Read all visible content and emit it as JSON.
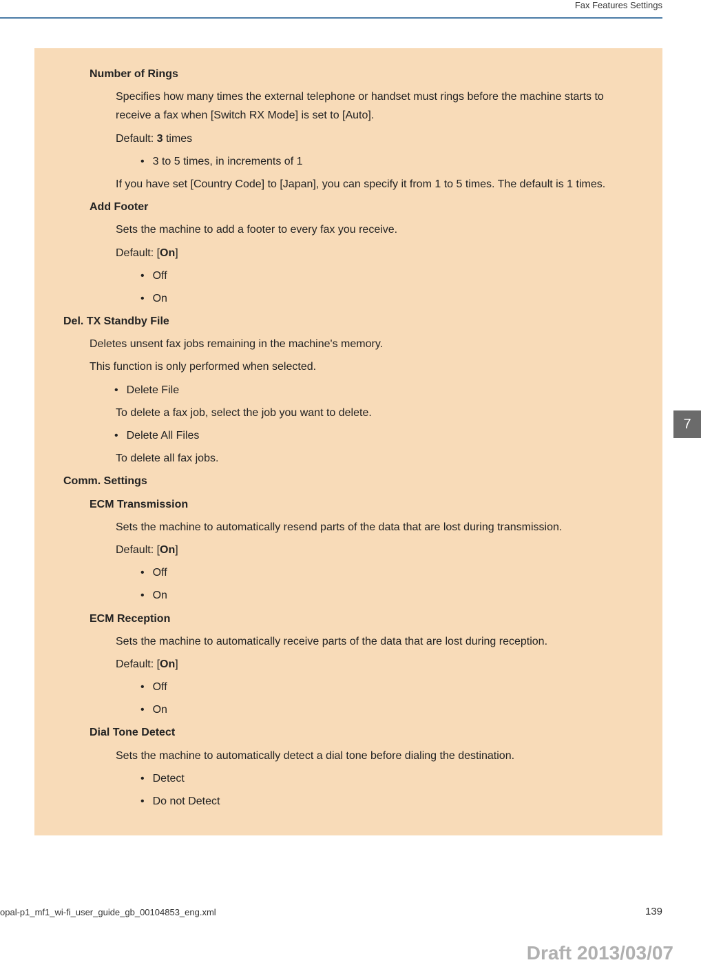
{
  "header": {
    "section_title": "Fax Features Settings"
  },
  "side_tab": "7",
  "content": {
    "number_of_rings": {
      "title": "Number of Rings",
      "desc": "Specifies how many times the external telephone or handset must rings before the machine starts to receive a fax when [Switch RX Mode] is set to [Auto].",
      "default_prefix": "Default: ",
      "default_value": "3",
      "default_suffix": " times",
      "bullet1": "3 to 5 times, in increments of 1",
      "note": "If you have set [Country Code] to [Japan], you can specify it from 1 to 5 times. The default is 1 times."
    },
    "add_footer": {
      "title": "Add Footer",
      "desc": "Sets the machine to add a footer to every fax you receive.",
      "default_prefix": "Default: [",
      "default_value": "On",
      "default_suffix": "]",
      "opt1": "Off",
      "opt2": "On"
    },
    "del_tx": {
      "title": "Del. TX Standby File",
      "desc1": "Deletes unsent fax jobs remaining in the machine's memory.",
      "desc2": "This function is only performed when selected.",
      "opt1": "Delete File",
      "opt1_desc": "To delete a fax job, select the job you want to delete.",
      "opt2": "Delete All Files",
      "opt2_desc": "To delete all fax jobs."
    },
    "comm": {
      "title": "Comm. Settings",
      "ecm_tx": {
        "title": "ECM Transmission",
        "desc": "Sets the machine to automatically resend parts of the data that are lost during transmission.",
        "default_prefix": "Default: [",
        "default_value": "On",
        "default_suffix": "]",
        "opt1": "Off",
        "opt2": "On"
      },
      "ecm_rx": {
        "title": "ECM Reception",
        "desc": "Sets the machine to automatically receive parts of the data that are lost during reception.",
        "default_prefix": "Default: [",
        "default_value": "On",
        "default_suffix": "]",
        "opt1": "Off",
        "opt2": "On"
      },
      "dial_tone": {
        "title": "Dial Tone Detect",
        "desc": "Sets the machine to automatically detect a dial tone before dialing the destination.",
        "opt1": "Detect",
        "opt2": "Do not Detect"
      }
    }
  },
  "footer": {
    "filename": "opal-p1_mf1_wi-fi_user_guide_gb_00104853_eng.xml",
    "page": "139",
    "draft": "Draft 2013/03/07"
  }
}
